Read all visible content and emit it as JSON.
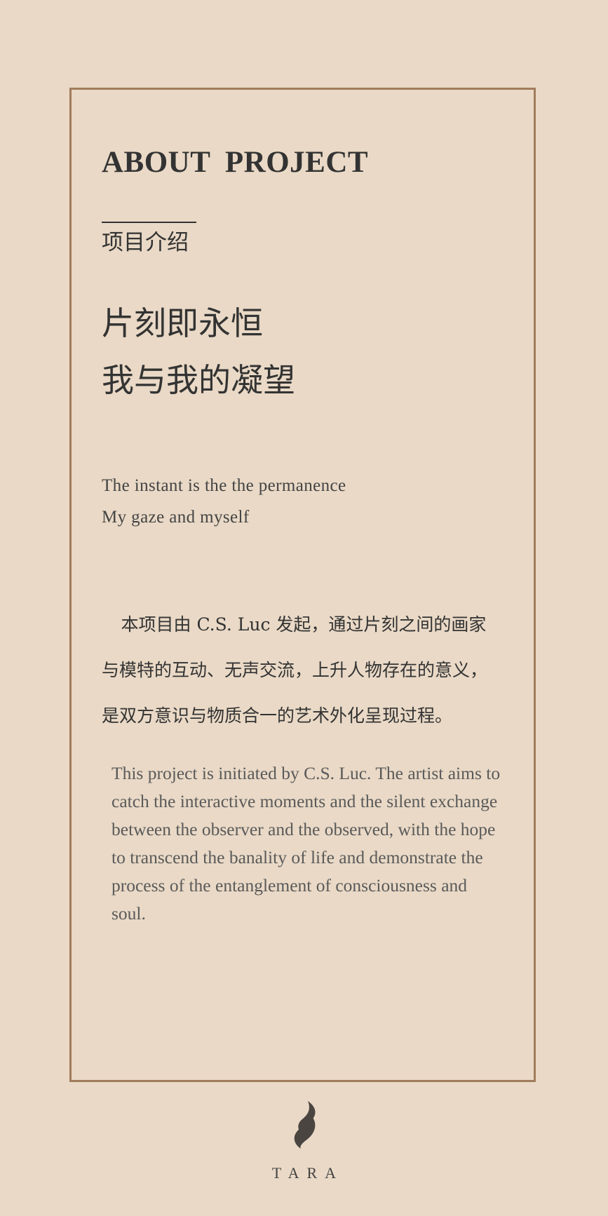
{
  "header": {
    "title_en": "ABOUT  PROJECT",
    "title_cn": "项目介绍"
  },
  "headline": {
    "cn_line1": "片刻即永恒",
    "cn_line2": "我与我的凝望",
    "en_line1": "The instant is the the permanence",
    "en_line2": "My gaze and myself"
  },
  "body": {
    "cn_paragraph": "本项目由 C.S. Luc 发起，通过片刻之间的画家与模特的互动、无声交流，上升人物存在的意义，是双方意识与物质合一的艺术外化呈现过程。",
    "en_paragraph": "This project is initiated by C.S. Luc. The artist aims to catch the interactive moments and the silent exchange between the observer and the observed, with the hope to transcend the banality of life and demonstrate the process of the entanglement of consciousness and soul."
  },
  "brand": {
    "logo_icon": "flame-s-icon",
    "name": "TARA"
  },
  "colors": {
    "background": "#e9d9c6",
    "frame_border": "#a27c5c",
    "text": "#333333"
  }
}
